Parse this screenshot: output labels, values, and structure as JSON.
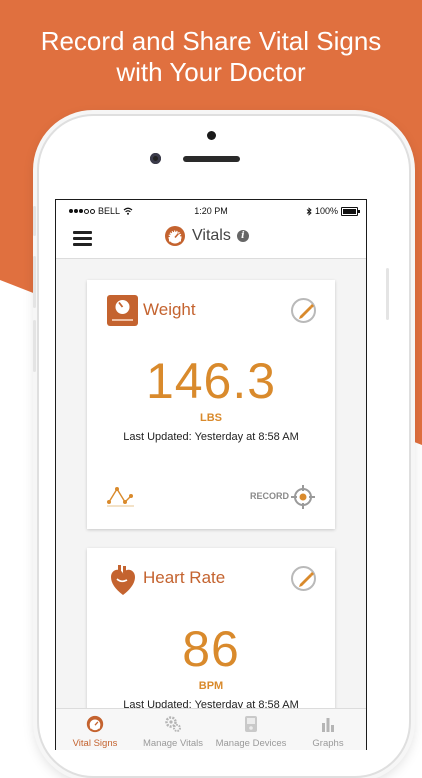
{
  "headline": {
    "line1": "Record and Share Vital Signs",
    "line2": "with Your Doctor"
  },
  "colors": {
    "accent": "#e0703f",
    "brand": "#c4632f",
    "value": "#d98a2c"
  },
  "status_bar": {
    "carrier": "BELL",
    "time": "1:20 PM",
    "battery": "100%"
  },
  "nav": {
    "title": "Vitals",
    "menu_icon": "hamburger-icon",
    "info_icon": "info-icon",
    "title_icon": "speedometer-icon"
  },
  "weight_card": {
    "title": "Weight",
    "value": "146.3",
    "unit": "LBS",
    "updated": "Last Updated: Yesterday at 8:58 AM",
    "record_label": "RECORD"
  },
  "heart_card": {
    "title": "Heart Rate",
    "value": "86",
    "unit": "BPM",
    "updated": "Last Updated: Yesterday at 8:58 AM"
  },
  "tabs": [
    {
      "label": "Vital Signs",
      "icon": "speedometer-icon",
      "active": true
    },
    {
      "label": "Manage Vitals",
      "icon": "gears-icon",
      "active": false
    },
    {
      "label": "Manage Devices",
      "icon": "device-icon",
      "active": false
    },
    {
      "label": "Graphs",
      "icon": "bar-chart-icon",
      "active": false
    }
  ]
}
